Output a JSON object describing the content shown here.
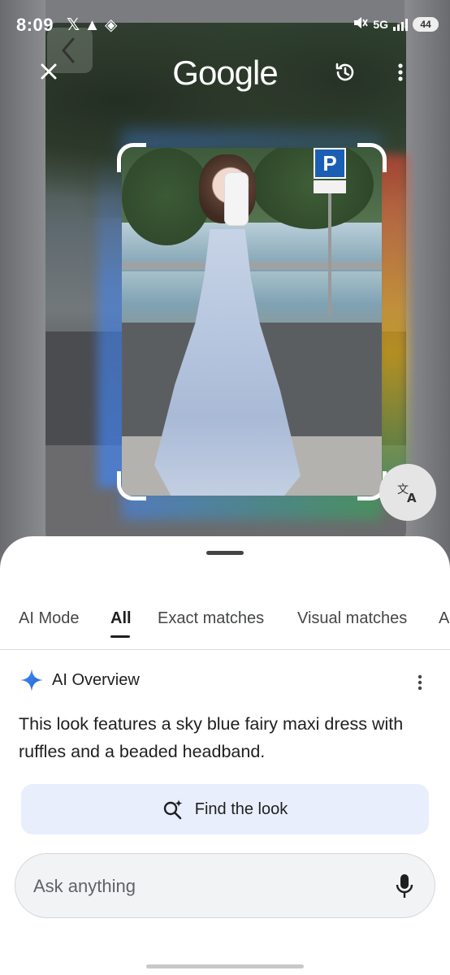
{
  "status_bar": {
    "time": "8:09",
    "app_icons": "𝕏 ▲ ◈",
    "network": "5G",
    "battery": "44"
  },
  "header": {
    "logo": "Google"
  },
  "icons": {
    "close": "close-icon",
    "history": "history-icon",
    "more": "more-vert-icon",
    "translate": "translate-icon",
    "back": "back-chevron-icon",
    "sparkle": "gemini-sparkle-icon",
    "find_look": "search-sparkle-icon",
    "mic": "mic-icon"
  },
  "tabs": [
    {
      "label": "AI Mode"
    },
    {
      "label": "All"
    },
    {
      "label": "Exact matches"
    },
    {
      "label": "Visual matches"
    },
    {
      "label": "A"
    }
  ],
  "active_tab": "All",
  "ai_overview": {
    "title": "AI Overview",
    "text": "This look features a sky blue fairy maxi dress with ruffles and a beaded headband."
  },
  "find_button": {
    "label": "Find the look"
  },
  "ask": {
    "placeholder": "Ask anything"
  },
  "colors": {
    "accent_blue": "#4285F4",
    "find_button_bg": "#E8EEFC",
    "sheet_bg": "#FFFFFF"
  }
}
